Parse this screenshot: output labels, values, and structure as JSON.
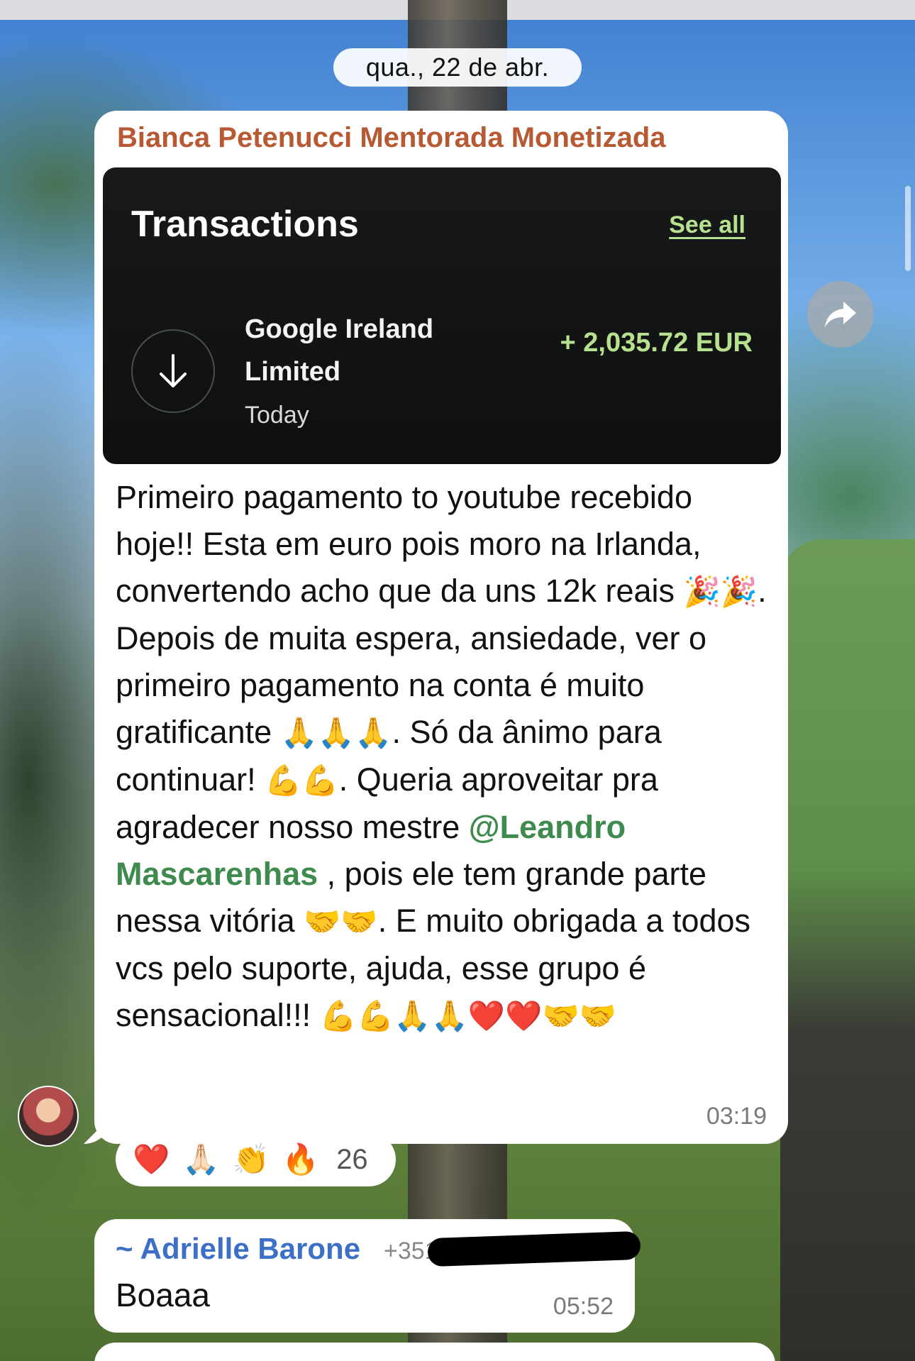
{
  "date_separator": "qua., 22 de abr.",
  "messages": [
    {
      "sender": "Bianca Petenucci Mentorada Monetizada",
      "card": {
        "title": "Transactions",
        "see_all": "See all",
        "transaction_name": "Google Ireland Limited",
        "transaction_date": "Today",
        "amount": "+ 2,035.72 EUR",
        "direction_icon": "arrow-down-icon"
      },
      "text_parts": {
        "p1": "Primeiro pagamento to youtube recebido hoje!! Esta em euro pois moro na Irlanda, convertendo acho que da uns 12k reais ",
        "e1": "🎉🎉",
        "p2": ". Depois de muita espera, ansiedade, ver o primeiro pagamento na conta é muito gratificante ",
        "e2": "🙏🙏🙏",
        "p3": ". Só da ânimo para continuar! ",
        "e3": "💪💪",
        "p4": ". Queria aproveitar pra agradecer nosso mestre ",
        "mention": "@Leandro Mascarenhas",
        "p5": " , pois ele tem grande parte nessa vitória ",
        "e4": "🤝🤝",
        "p6": ". E muito obrigada a todos vcs pelo suporte, ajuda, esse grupo é sensacional!!! ",
        "e5": "💪💪🙏🙏❤️❤️🤝🤝"
      },
      "time": "03:19",
      "reactions": {
        "emojis": [
          "❤️",
          "🙏🏻",
          "👏",
          "🔥"
        ],
        "count": "26"
      }
    },
    {
      "sender": "~ Adrielle Barone",
      "phone": "+351 ··· ··· 145",
      "text": "Boaaa",
      "time": "05:52"
    }
  ],
  "forward_icon": "forward-arrow-icon"
}
